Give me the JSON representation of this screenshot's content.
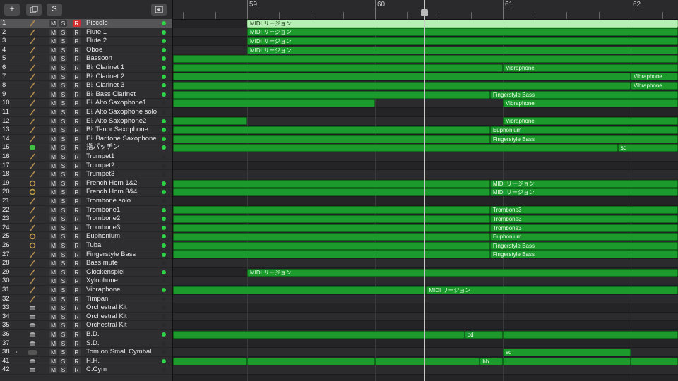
{
  "toolbar": {
    "add_label": "+",
    "s_label": "S"
  },
  "ruler": {
    "bars": [
      "59",
      "60",
      "61",
      "62"
    ]
  },
  "msr": {
    "m": "M",
    "s": "S",
    "r": "R"
  },
  "tracks": [
    {
      "n": "1",
      "name": "Piccolo",
      "selected": true,
      "armed": true,
      "led": true,
      "icon": "flute-icon"
    },
    {
      "n": "2",
      "name": "Flute 1",
      "led": true,
      "icon": "flute-icon"
    },
    {
      "n": "3",
      "name": "Flute 2",
      "led": true,
      "icon": "flute-icon"
    },
    {
      "n": "4",
      "name": "Oboe",
      "led": true,
      "icon": "oboe-icon"
    },
    {
      "n": "5",
      "name": "Bassoon",
      "led": true,
      "icon": "bassoon-icon"
    },
    {
      "n": "6",
      "name": "B♭ Clarinet 1",
      "led": true,
      "icon": "clarinet-icon"
    },
    {
      "n": "7",
      "name": "B♭ Clarinet 2",
      "led": true,
      "icon": "clarinet-icon"
    },
    {
      "n": "8",
      "name": "B♭ Clarinet 3",
      "led": true,
      "icon": "clarinet-icon"
    },
    {
      "n": "9",
      "name": "B♭ Bass Clarinet",
      "led": true,
      "icon": "clarinet-icon"
    },
    {
      "n": "10",
      "name": "E♭ Alto Saxophone1",
      "led": false,
      "icon": "saxophone-icon"
    },
    {
      "n": "11",
      "name": "E♭ Alto Saxophone solo",
      "led": false,
      "icon": "saxophone-icon"
    },
    {
      "n": "12",
      "name": "E♭ Alto Saxophone2",
      "led": true,
      "icon": "saxophone-icon"
    },
    {
      "n": "13",
      "name": "B♭ Tenor Saxophone",
      "led": true,
      "icon": "saxophone-icon"
    },
    {
      "n": "14",
      "name": "E♭ Baritone Saxophone",
      "led": true,
      "icon": "saxophone-icon"
    },
    {
      "n": "15",
      "name": "指パッチン",
      "led": true,
      "icon": "green-circle-icon"
    },
    {
      "n": "16",
      "name": "Trumpet1",
      "led": false,
      "icon": "trumpet-icon"
    },
    {
      "n": "17",
      "name": "Trumpet2",
      "led": false,
      "icon": "trumpet-icon"
    },
    {
      "n": "18",
      "name": "Trumpet3",
      "led": false,
      "icon": "trumpet-icon"
    },
    {
      "n": "19",
      "name": "French Horn 1&2",
      "led": true,
      "icon": "french-horn-icon"
    },
    {
      "n": "20",
      "name": "French Horn 3&4",
      "led": true,
      "icon": "french-horn-icon"
    },
    {
      "n": "21",
      "name": "Trombone solo",
      "led": false,
      "icon": "trombone-icon"
    },
    {
      "n": "22",
      "name": "Trombone1",
      "led": true,
      "icon": "trombone-icon"
    },
    {
      "n": "23",
      "name": "Trombone2",
      "led": true,
      "icon": "trombone-icon"
    },
    {
      "n": "24",
      "name": "Trombone3",
      "led": true,
      "icon": "trombone-icon"
    },
    {
      "n": "25",
      "name": "Euphonium",
      "led": true,
      "icon": "euphonium-icon"
    },
    {
      "n": "26",
      "name": "Tuba",
      "led": true,
      "icon": "tuba-icon"
    },
    {
      "n": "27",
      "name": "Fingerstyle Bass",
      "led": true,
      "icon": "bass-guitar-icon"
    },
    {
      "n": "28",
      "name": "Bass mute",
      "led": false,
      "icon": "bass-guitar-icon"
    },
    {
      "n": "29",
      "name": "Glockenspiel",
      "led": true,
      "icon": "glockenspiel-icon"
    },
    {
      "n": "30",
      "name": "Xylophone",
      "led": false,
      "icon": "xylophone-icon"
    },
    {
      "n": "31",
      "name": "Vibraphone",
      "led": true,
      "icon": "vibraphone-icon"
    },
    {
      "n": "32",
      "name": "Timpani",
      "led": false,
      "icon": "timpani-icon"
    },
    {
      "n": "33",
      "name": "Orchestral Kit",
      "led": false,
      "icon": "drum-kit-icon"
    },
    {
      "n": "34",
      "name": "Orchestral Kit",
      "led": false,
      "icon": "drum-kit-icon"
    },
    {
      "n": "35",
      "name": "Orchestral Kit",
      "led": false,
      "icon": "drum-kit-icon"
    },
    {
      "n": "36",
      "name": "B.D.",
      "led": true,
      "icon": "drum-icon"
    },
    {
      "n": "37",
      "name": "S.D.",
      "led": false,
      "icon": "drum-icon"
    },
    {
      "n": "38",
      "name": "Tom on Small Cymbal",
      "led": false,
      "icon": "track-stack-icon",
      "disclosure": true
    },
    {
      "n": "41",
      "name": "H.H.",
      "led": true,
      "icon": "drum-icon"
    },
    {
      "n": "42",
      "name": "C.Cym",
      "led": false,
      "icon": "drum-icon"
    }
  ],
  "regions": [
    {
      "t": 0,
      "start": 59,
      "end": 63,
      "label": "MIDI リージョン",
      "light": true
    },
    {
      "t": 1,
      "start": 59,
      "end": 63,
      "label": "MIDI リージョン"
    },
    {
      "t": 2,
      "start": 59,
      "end": 63,
      "label": "MIDI リージョン"
    },
    {
      "t": 3,
      "start": 59,
      "end": 63,
      "label": "MIDI リージョン"
    },
    {
      "t": 4,
      "start": 58.4,
      "end": 62.5,
      "label": ""
    },
    {
      "t": 4,
      "start": 62.5,
      "end": 63,
      "label": "Euphonium"
    },
    {
      "t": 5,
      "start": 58.4,
      "end": 61,
      "label": ""
    },
    {
      "t": 5,
      "start": 61,
      "end": 63,
      "label": "Vibraphone"
    },
    {
      "t": 6,
      "start": 58.4,
      "end": 62,
      "label": ""
    },
    {
      "t": 6,
      "start": 62,
      "end": 63,
      "label": "Vibraphone"
    },
    {
      "t": 7,
      "start": 58.4,
      "end": 62,
      "label": ""
    },
    {
      "t": 7,
      "start": 62,
      "end": 63,
      "label": "Vibraphone"
    },
    {
      "t": 8,
      "start": 58.4,
      "end": 60.9,
      "label": ""
    },
    {
      "t": 8,
      "start": 60.9,
      "end": 63,
      "label": "Fingerstyle Bass"
    },
    {
      "t": 9,
      "start": 58.4,
      "end": 60,
      "label": ""
    },
    {
      "t": 9,
      "start": 61,
      "end": 63,
      "label": "Vibraphone"
    },
    {
      "t": 11,
      "start": 58.4,
      "end": 59,
      "label": ""
    },
    {
      "t": 11,
      "start": 61,
      "end": 63,
      "label": "Vibraphone"
    },
    {
      "t": 12,
      "start": 58.4,
      "end": 60.9,
      "label": ""
    },
    {
      "t": 12,
      "start": 60.9,
      "end": 63,
      "label": "Euphonium"
    },
    {
      "t": 13,
      "start": 58.4,
      "end": 60.9,
      "label": ""
    },
    {
      "t": 13,
      "start": 60.9,
      "end": 63,
      "label": "Fingerstyle Bass"
    },
    {
      "t": 14,
      "start": 58.4,
      "end": 61.9,
      "label": ""
    },
    {
      "t": 14,
      "start": 61.9,
      "end": 63,
      "label": "sd"
    },
    {
      "t": 18,
      "start": 58.4,
      "end": 60.9,
      "label": ""
    },
    {
      "t": 18,
      "start": 60.9,
      "end": 63,
      "label": "MIDI リージョン"
    },
    {
      "t": 19,
      "start": 58.4,
      "end": 60.9,
      "label": ""
    },
    {
      "t": 19,
      "start": 60.9,
      "end": 63,
      "label": "MIDI リージョン"
    },
    {
      "t": 21,
      "start": 58.4,
      "end": 60.9,
      "label": ""
    },
    {
      "t": 21,
      "start": 60.9,
      "end": 63,
      "label": "Trombone3"
    },
    {
      "t": 22,
      "start": 58.4,
      "end": 60.9,
      "label": ""
    },
    {
      "t": 22,
      "start": 60.9,
      "end": 63,
      "label": "Trombone3"
    },
    {
      "t": 23,
      "start": 58.4,
      "end": 60.9,
      "label": ""
    },
    {
      "t": 23,
      "start": 60.9,
      "end": 63,
      "label": "Trombone3"
    },
    {
      "t": 24,
      "start": 58.4,
      "end": 60.9,
      "label": ""
    },
    {
      "t": 24,
      "start": 60.9,
      "end": 63,
      "label": "Euphonium"
    },
    {
      "t": 25,
      "start": 58.4,
      "end": 60.9,
      "label": ""
    },
    {
      "t": 25,
      "start": 60.9,
      "end": 63,
      "label": "Fingerstyle Bass"
    },
    {
      "t": 26,
      "start": 58.4,
      "end": 60.9,
      "label": ""
    },
    {
      "t": 26,
      "start": 60.9,
      "end": 63,
      "label": "Fingerstyle Bass"
    },
    {
      "t": 28,
      "start": 59,
      "end": 63,
      "label": "MIDI リージョン"
    },
    {
      "t": 30,
      "start": 58.4,
      "end": 60.4,
      "label": ""
    },
    {
      "t": 30,
      "start": 60.4,
      "end": 63,
      "label": "MIDI リージョン"
    },
    {
      "t": 35,
      "start": 58.4,
      "end": 60.7,
      "label": ""
    },
    {
      "t": 35,
      "start": 60.7,
      "end": 61,
      "label": "bd"
    },
    {
      "t": 35,
      "start": 61,
      "end": 63,
      "label": ""
    },
    {
      "t": 37,
      "start": 61,
      "end": 62,
      "label": "sd"
    },
    {
      "t": 38,
      "start": 58.4,
      "end": 59,
      "label": ""
    },
    {
      "t": 38,
      "start": 59,
      "end": 60,
      "label": ""
    },
    {
      "t": 38,
      "start": 60,
      "end": 60.82,
      "label": ""
    },
    {
      "t": 38,
      "start": 60.82,
      "end": 61,
      "label": "hh"
    },
    {
      "t": 38,
      "start": 61,
      "end": 62,
      "label": ""
    },
    {
      "t": 38,
      "start": 62,
      "end": 63,
      "label": ""
    }
  ],
  "playhead_bar": 60.38,
  "colors": {
    "region": "#1c9a2c",
    "region_light": "#b7f0b5",
    "led_on": "#2fd34a",
    "record": "#d03030"
  }
}
